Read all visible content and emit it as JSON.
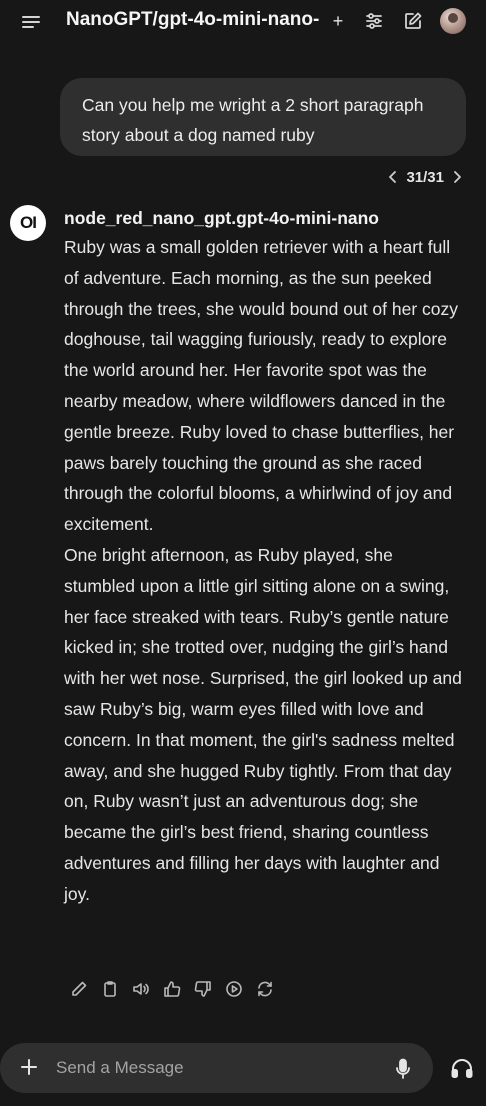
{
  "header": {
    "model_title": "NanoGPT/gpt-4o-mini-nano-",
    "add_model_symbol": "+",
    "icons": [
      "menu-icon",
      "sliders-icon",
      "edit-icon"
    ]
  },
  "user_message": {
    "text": "Can you help me wright a 2 short paragraph story about a dog named ruby"
  },
  "pager": {
    "label": "31/31"
  },
  "assistant": {
    "logo_text": "OI",
    "name": "node_red_nano_gpt.gpt-4o-mini-nano",
    "paragraphs": [
      "Ruby was a small golden retriever with a heart full of adventure. Each morning, as the sun peeked through the trees, she would bound out of her cozy doghouse, tail wagging furiously, ready to explore the world around her. Her favorite spot was the nearby meadow, where wildflowers danced in the gentle breeze. Ruby loved to chase butterflies, her paws barely touching the ground as she raced through the colorful blooms, a whirlwind of joy and excitement.",
      "One bright afternoon, as Ruby played, she stumbled upon a little girl sitting alone on a swing, her face streaked with tears. Ruby’s gentle nature kicked in; she trotted over, nudging the girl’s hand with her wet nose. Surprised, the girl looked up and saw Ruby’s big, warm eyes filled with love and concern. In that moment, the girl's sadness melted away, and she hugged Ruby tightly. From that day on, Ruby wasn’t just an adventurous dog; she became the girl’s best friend, sharing countless adventures and filling her days with laughter and joy."
    ],
    "action_icons": [
      "edit-icon",
      "copy-icon",
      "speaker-icon",
      "thumbs-up-icon",
      "thumbs-down-icon",
      "play-icon",
      "regenerate-icon"
    ]
  },
  "composer": {
    "placeholder": "Send a Message"
  },
  "colors": {
    "background": "#171717",
    "bubble": "#2f2f2f",
    "text": "#ececec"
  }
}
